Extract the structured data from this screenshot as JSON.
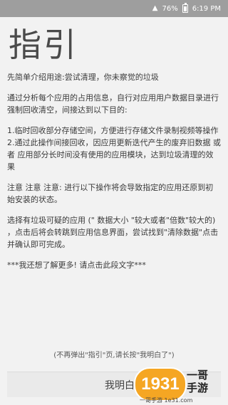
{
  "status_bar": {
    "battery_percent": "76%",
    "time": "6:19 PM"
  },
  "page": {
    "title": "指引",
    "intro": "先简单介绍用途:尝试清理，你未察觉的垃圾",
    "paragraphs": [
      "通过分析每个应用的占用信息，自行对应用用户数据目录进行强制回收清空，间接达到以下目的:",
      "1.临时回收部分存储空间，方便进行存储文件录制视频等操作\n2.通过此操作间接回收，因应用更新迭代产生的废弃旧数据 或者 应用部分长时间没有使用的应用模块，达到垃圾清理的效果",
      "注意 注意 注意:  进行以下操作将会导致指定的应用还原到初始安装的状态。",
      "选择有垃圾可疑的应用 (\" 数据大小 \"较大或者\"倍数\"较大的) ，点击后将会转跳到应用信息界面，尝试找到\"清除数据\"点击并确认即可完成。",
      "***我还想了解更多! 请点击此段文字***"
    ],
    "footer_hint": "(不再弹出\"指引\"页,请长按\"我明白了\")",
    "confirm_label": "我明白了"
  },
  "watermark": {
    "badge_text": "1931",
    "name": "一哥\n手游",
    "site": "一哥手游 1e31.com"
  }
}
